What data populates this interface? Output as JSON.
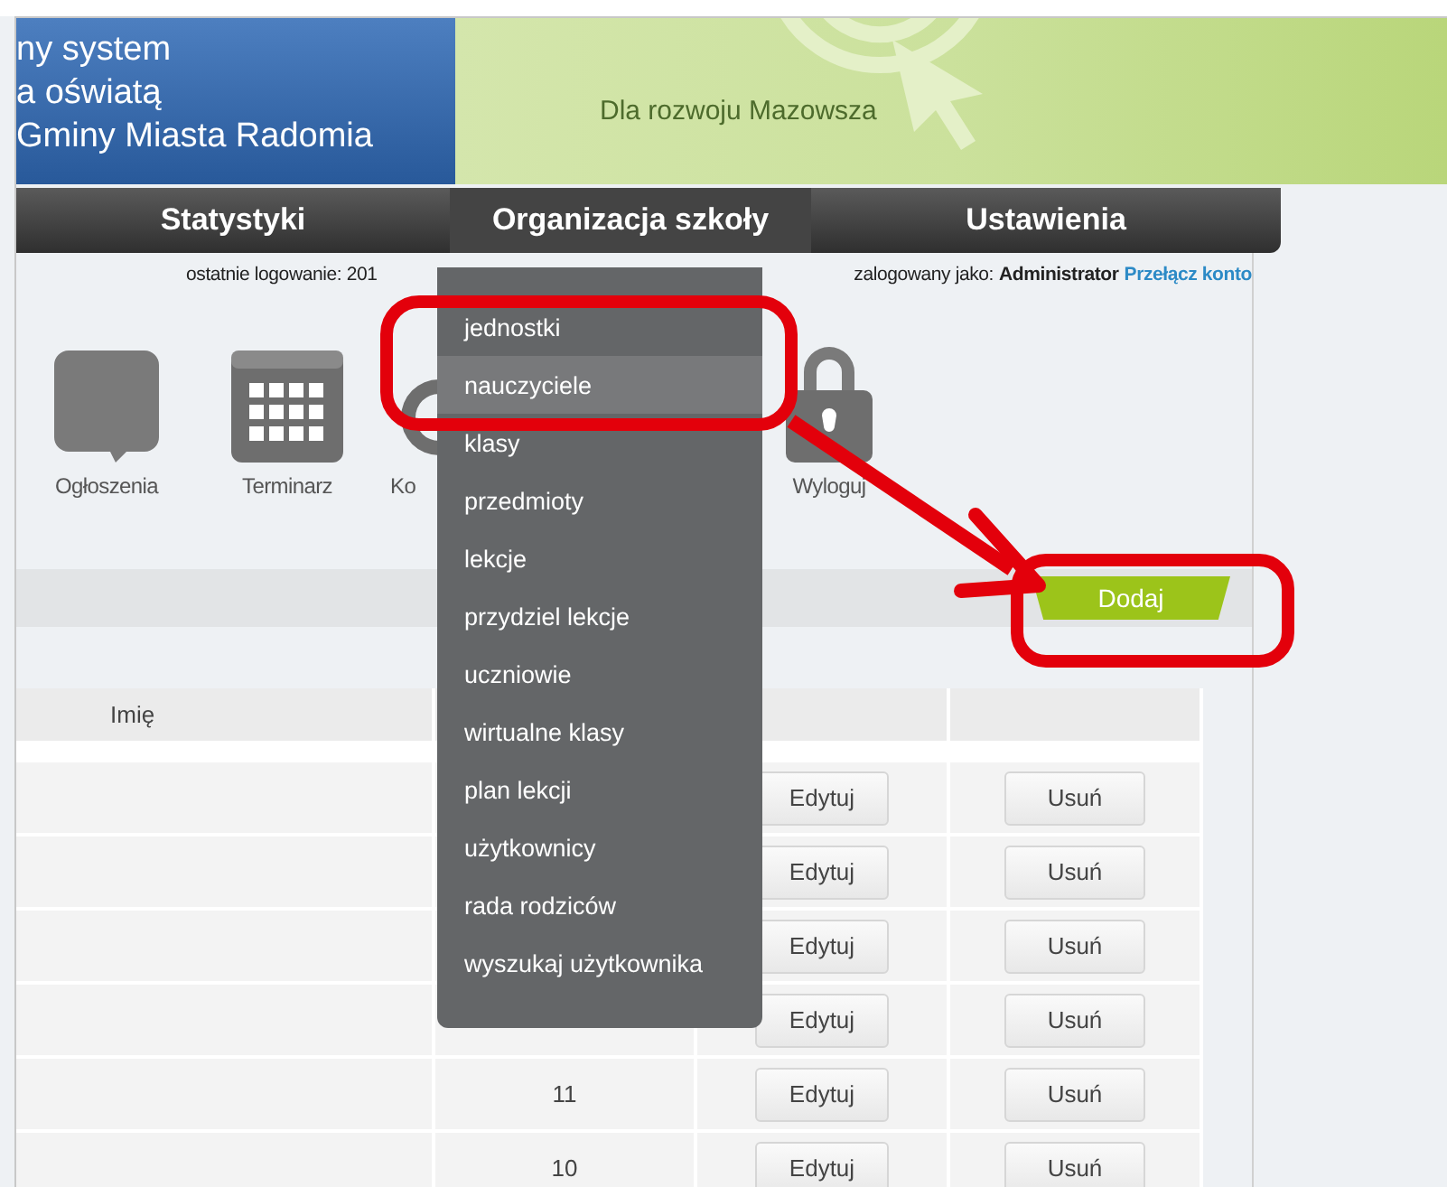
{
  "header": {
    "title_lines": [
      "ny system",
      "a oświatą",
      "Gminy Miasta Radomia"
    ],
    "slogan": "Dla rozwoju Mazowsza"
  },
  "nav": [
    {
      "label": "Statystyki",
      "selected": false
    },
    {
      "label": "Organizacja szkoły",
      "selected": true
    },
    {
      "label": "Ustawienia",
      "selected": false
    }
  ],
  "login_info": {
    "last_login": "ostatnie logowanie: 201",
    "logged_as": "zalogowany jako:",
    "user": "Administrator",
    "switch_link": "Przełącz konto"
  },
  "shortcuts": [
    {
      "kind": "speech",
      "label": "Ogłoszenia"
    },
    {
      "kind": "calendar",
      "label": "Terminarz"
    },
    {
      "kind": "gear",
      "label": "Ko"
    },
    {
      "kind": "lock",
      "label": "Wyloguj"
    }
  ],
  "add_button": "Dodaj",
  "table": {
    "columns": [
      "Imię"
    ],
    "rows": [
      {
        "number": "",
        "edit": "Edytuj",
        "delete": "Usuń"
      },
      {
        "number": "",
        "edit": "Edytuj",
        "delete": "Usuń"
      },
      {
        "number": "",
        "edit": "Edytuj",
        "delete": "Usuń"
      },
      {
        "number": "",
        "edit": "Edytuj",
        "delete": "Usuń"
      },
      {
        "number": "11",
        "edit": "Edytuj",
        "delete": "Usuń"
      },
      {
        "number": "10",
        "edit": "Edytuj",
        "delete": "Usuń"
      }
    ]
  },
  "dropdown": [
    {
      "label": "jednostki",
      "selected": false
    },
    {
      "label": "nauczyciele",
      "selected": true
    },
    {
      "label": "klasy",
      "selected": false
    },
    {
      "label": "przedmioty",
      "selected": false
    },
    {
      "label": "lekcje",
      "selected": false
    },
    {
      "label": "przydziel lekcje",
      "selected": false
    },
    {
      "label": "uczniowie",
      "selected": false
    },
    {
      "label": "wirtualne klasy",
      "selected": false
    },
    {
      "label": "plan lekcji",
      "selected": false
    },
    {
      "label": "użytkownicy",
      "selected": false
    },
    {
      "label": "rada rodziców",
      "selected": false
    },
    {
      "label": "wyszukaj użytkownika",
      "selected": false
    }
  ]
}
